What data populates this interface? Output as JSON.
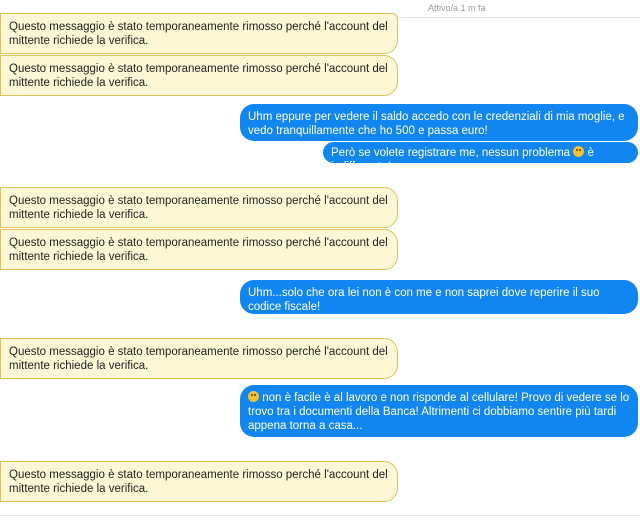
{
  "header": {
    "status": "Attivo/a 1 m fa"
  },
  "messages": {
    "removed_text": "Questo messaggio è stato temporaneamente rimosso perché l'account del mittente richiede la verifica.",
    "sent_1": "Uhm eppure per vedere il saldo accedo con le credenziali di mia moglie, e vedo tranquillamente che ho 500 e passa euro!",
    "sent_2_before": "Però se volete registrare me, nessun problema",
    "sent_2_after": "è indifferente!",
    "sent_3": "Uhm...solo che ora lei non è con me e non saprei dove reperire il suo codice fiscale!",
    "sent_4": "non è facile è al lavoro e non risponde al cellulare! Provo di vedere se lo trovo tra i documenti della Banca! Altrimenti ci dobbiamo sentire più tardi appena torna a casa...",
    "emoji_names": [
      "grinning-face-emoji",
      "smiling-face-emoji"
    ]
  },
  "colors": {
    "sent_bubble": "#1185f0",
    "removed_bubble_bg": "#fdf7d6",
    "removed_bubble_border": "#e3c25a"
  }
}
